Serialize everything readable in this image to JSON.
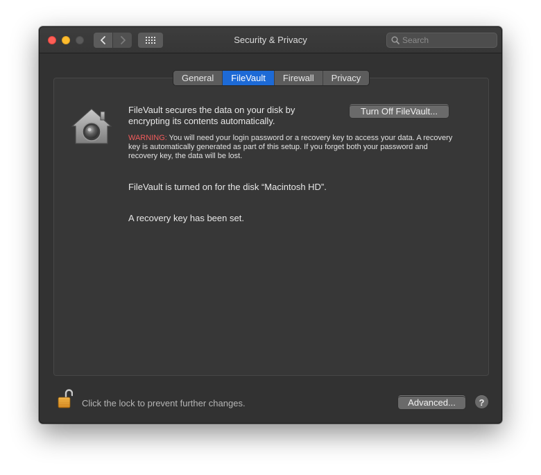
{
  "window": {
    "title": "Security & Privacy",
    "search_placeholder": "Search"
  },
  "tabs": [
    {
      "label": "General",
      "active": false
    },
    {
      "label": "FileVault",
      "active": true
    },
    {
      "label": "Firewall",
      "active": false
    },
    {
      "label": "Privacy",
      "active": false
    }
  ],
  "filevault": {
    "description": "FileVault secures the data on your disk by encrypting its contents automatically.",
    "turn_off_button": "Turn Off FileVault...",
    "warning_label": "WARNING:",
    "warning_text": " You will need your login password or a recovery key to access your data. A recovery key is automatically generated as part of this setup. If you forget both your password and recovery key, the data will be lost.",
    "status_disk": "FileVault is turned on for the disk “Macintosh HD”.",
    "status_key": "A recovery key has been set."
  },
  "footer": {
    "lock_text": "Click the lock to prevent further changes.",
    "advanced_button": "Advanced...",
    "help_label": "?"
  },
  "icons": {
    "back": "chevron-left-icon",
    "forward": "chevron-right-icon",
    "grid": "grid-icon",
    "search": "search-icon",
    "filevault": "filevault-house-icon",
    "lock": "unlocked-padlock-icon"
  },
  "colors": {
    "accent": "#1d6ad6",
    "warning": "#f35c5c",
    "close": "#fe5f57",
    "minimize": "#febc2e"
  }
}
